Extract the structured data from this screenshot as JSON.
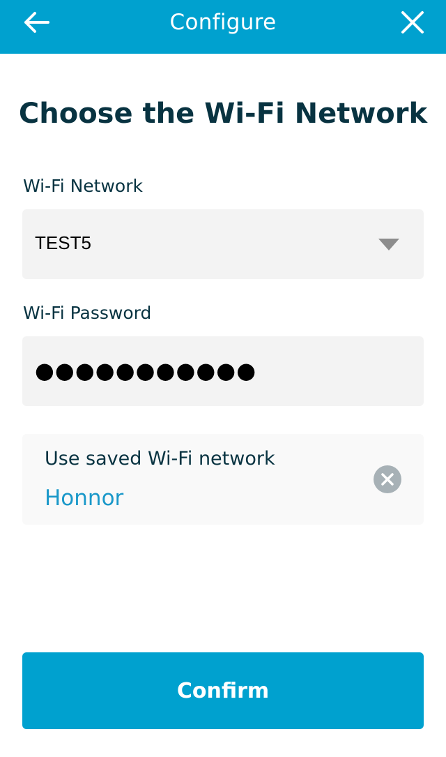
{
  "header": {
    "title": "Configure",
    "back_icon": "arrow-left-icon",
    "close_icon": "close-icon",
    "bg_color": "#00a1cf"
  },
  "page_title": "Choose the Wi-Fi Network",
  "network": {
    "label": "Wi-Fi Network",
    "selected": "TEST5",
    "dropdown_icon": "caret-down-icon"
  },
  "password": {
    "label": "Wi-Fi Password",
    "value": "●●●●●●●●●●●"
  },
  "saved_network": {
    "label": "Use saved Wi-Fi network",
    "name": "Honnor",
    "clear_icon": "clear-icon",
    "name_color": "#1a98c9"
  },
  "confirm_label": "Confirm",
  "colors": {
    "accent": "#00a1cf",
    "heading": "#083341",
    "field_bg": "#f3f3f3"
  }
}
